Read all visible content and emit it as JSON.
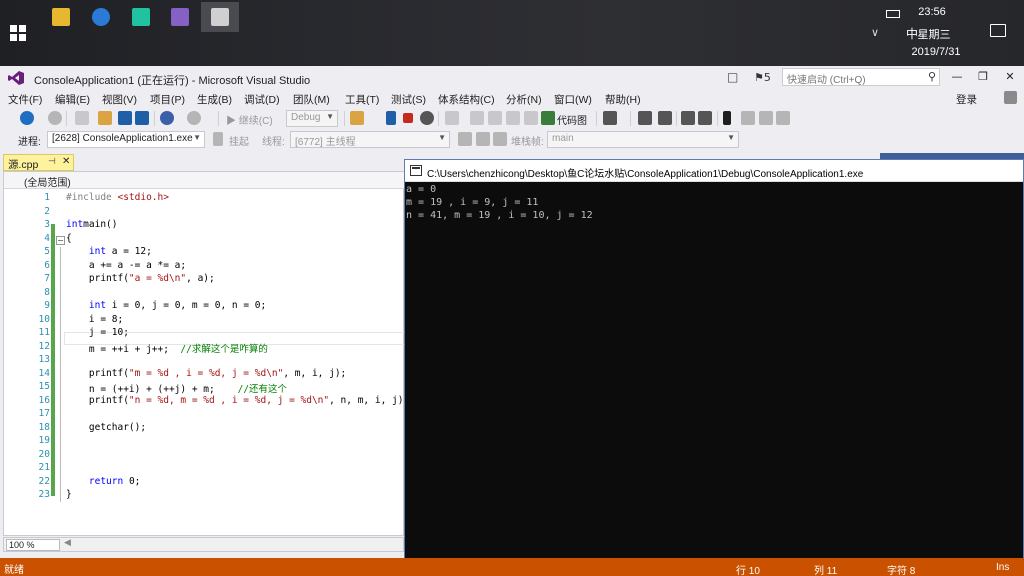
{
  "taskbar": {
    "apps": [
      {
        "icon": "file-explorer-icon",
        "color": "#e8b730"
      },
      {
        "icon": "edge-icon",
        "color": "#2b7bd6"
      },
      {
        "icon": "pycharm-icon",
        "color": "#21c2a0"
      },
      {
        "icon": "visual-studio-icon",
        "color": "#8661c5"
      },
      {
        "icon": "console-app-icon",
        "color": "#d0d0d0"
      }
    ],
    "time": "23:56",
    "weekday": "星期三",
    "date": "2019/7/31",
    "ime": "中"
  },
  "vs": {
    "title": "ConsoleApplication1 (正在运行) - Microsoft Visual Studio",
    "notifications": "5",
    "quick_launch_placeholder": "快速启动 (Ctrl+Q)",
    "login": "登录",
    "menu": [
      "文件(F)",
      "编辑(E)",
      "视图(V)",
      "项目(P)",
      "生成(B)",
      "调试(D)",
      "团队(M)",
      "工具(T)",
      "测试(S)",
      "体系结构(C)",
      "分析(N)",
      "窗口(W)",
      "帮助(H)"
    ],
    "toolbar": {
      "continue_label": "继续(C)",
      "config_value": "Debug",
      "codemap_label": "代码图",
      "process_label": "进程:",
      "process_value": "[2628] ConsoleApplication1.exe",
      "suspend_label": "挂起",
      "thread_label": "线程:",
      "thread_value": "[6772] 主线程",
      "stackframe_label": "堆栈帧:",
      "stackframe_value": "main"
    }
  },
  "editor": {
    "tab_label": "源.cpp",
    "scope": "(全局范围)",
    "zoom": "100 %",
    "line_numbers": [
      "1",
      "2",
      "3",
      "4",
      "5",
      "6",
      "7",
      "8",
      "9",
      "10",
      "11",
      "12",
      "13",
      "14",
      "15",
      "16",
      "17",
      "18",
      "19",
      "20",
      "21",
      "22",
      "23"
    ]
  },
  "console": {
    "path": "C:\\Users\\chenzhicong\\Desktop\\鱼C论坛水贴\\ConsoleApplication1\\Debug\\ConsoleApplication1.exe",
    "lines": [
      "a = 0",
      "m = 19 , i = 9, j = 11",
      "n = 41, m = 19 , i = 10, j = 12"
    ]
  },
  "status": {
    "text": "就绪",
    "row": "行 10",
    "col": "列 11",
    "char": "字符 8",
    "mode": "Ins"
  }
}
